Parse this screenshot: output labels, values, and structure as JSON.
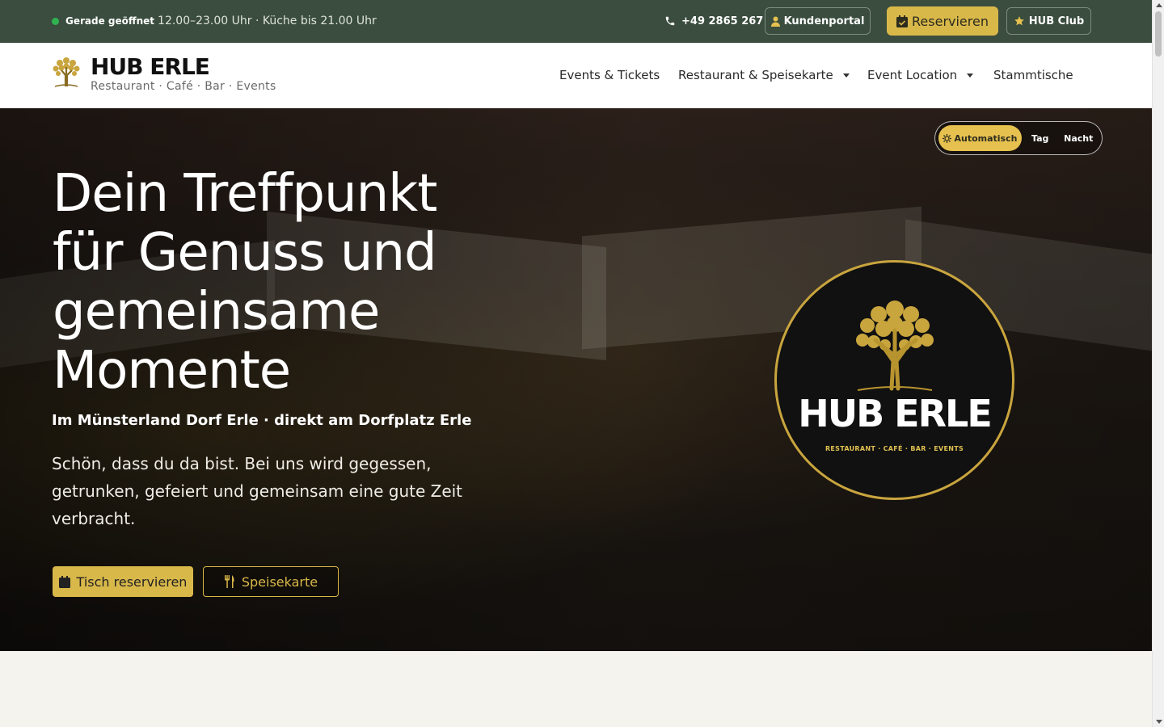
{
  "topbar": {
    "status_label": "Gerade geöffnet",
    "hours": "12.00–23.00 Uhr · Küche bis 21.00 Uhr",
    "phone": "+49 2865 267",
    "kundenportal": "Kundenportal",
    "reservieren": "Reservieren",
    "hub_club": "HUB Club",
    "status_color": "#2fb350",
    "accent": "#d9b84a",
    "bg": "#3a4d3e"
  },
  "header": {
    "brand_title": "HUB ERLE",
    "brand_subtitle": "Restaurant · Café · Bar · Events",
    "nav": [
      {
        "label": "Events & Tickets",
        "dropdown": false
      },
      {
        "label": "Restaurant & Speisekarte",
        "dropdown": true
      },
      {
        "label": "Event Location",
        "dropdown": true
      },
      {
        "label": "Stammtische",
        "dropdown": false
      }
    ]
  },
  "mode_toggle": {
    "auto": "Automatisch",
    "day": "Tag",
    "night": "Nacht",
    "selected": "Automatisch"
  },
  "hero": {
    "title": "Dein Treffpunkt für Genuss und gemeinsame Momente",
    "subtitle": "Im Münsterland Dorf Erle · direkt am Dorfplatz Erle",
    "text": "Schön, dass du da bist. Bei uns wird gegessen, getrunken, gefeiert und gemeinsam eine gute Zeit verbracht.",
    "btn_reserve": "Tisch reservieren",
    "btn_menu": "Speisekarte"
  },
  "logo": {
    "title": "HUB ERLE",
    "subtitle": "RESTAURANT · CAFÉ · BAR · EVENTS"
  }
}
